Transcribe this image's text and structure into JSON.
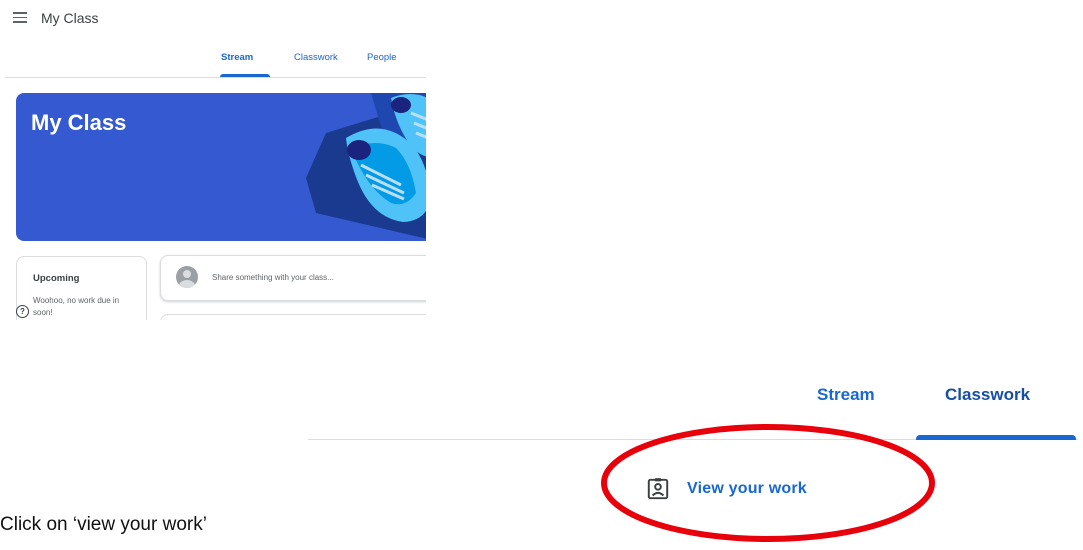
{
  "top_screenshot": {
    "header": {
      "title": "My Class",
      "menu_icon": "hamburger-menu-icon"
    },
    "tabs": [
      {
        "label": "Stream",
        "active": true
      },
      {
        "label": "Classwork",
        "active": false
      },
      {
        "label": "People",
        "active": false
      }
    ],
    "banner": {
      "title": "My Class",
      "color": "#3459d0"
    },
    "upcoming": {
      "title": "Upcoming",
      "text": "Woohoo, no work due in soon!"
    },
    "share": {
      "placeholder": "Share something with your class..."
    }
  },
  "bottom_screenshot": {
    "tabs": [
      {
        "label": "Stream",
        "active": false
      },
      {
        "label": "Classwork",
        "active": true
      }
    ],
    "view_work": {
      "label": "View your work",
      "icon": "assignment-ind-icon"
    },
    "highlight_color": "#e8000b"
  },
  "instruction": "Click on ‘view your work’",
  "colors": {
    "accent": "#1967d2",
    "divider": "#dadce0"
  }
}
